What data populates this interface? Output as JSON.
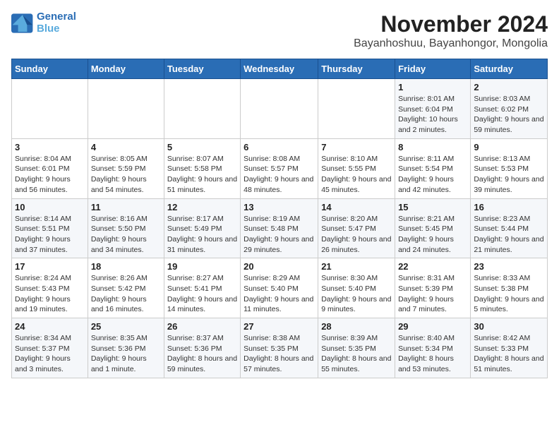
{
  "header": {
    "logo_line1": "General",
    "logo_line2": "Blue",
    "month_title": "November 2024",
    "location": "Bayanhoshuu, Bayanhongor, Mongolia"
  },
  "weekdays": [
    "Sunday",
    "Monday",
    "Tuesday",
    "Wednesday",
    "Thursday",
    "Friday",
    "Saturday"
  ],
  "weeks": [
    [
      {
        "day": "",
        "info": ""
      },
      {
        "day": "",
        "info": ""
      },
      {
        "day": "",
        "info": ""
      },
      {
        "day": "",
        "info": ""
      },
      {
        "day": "",
        "info": ""
      },
      {
        "day": "1",
        "info": "Sunrise: 8:01 AM\nSunset: 6:04 PM\nDaylight: 10 hours and 2 minutes."
      },
      {
        "day": "2",
        "info": "Sunrise: 8:03 AM\nSunset: 6:02 PM\nDaylight: 9 hours and 59 minutes."
      }
    ],
    [
      {
        "day": "3",
        "info": "Sunrise: 8:04 AM\nSunset: 6:01 PM\nDaylight: 9 hours and 56 minutes."
      },
      {
        "day": "4",
        "info": "Sunrise: 8:05 AM\nSunset: 5:59 PM\nDaylight: 9 hours and 54 minutes."
      },
      {
        "day": "5",
        "info": "Sunrise: 8:07 AM\nSunset: 5:58 PM\nDaylight: 9 hours and 51 minutes."
      },
      {
        "day": "6",
        "info": "Sunrise: 8:08 AM\nSunset: 5:57 PM\nDaylight: 9 hours and 48 minutes."
      },
      {
        "day": "7",
        "info": "Sunrise: 8:10 AM\nSunset: 5:55 PM\nDaylight: 9 hours and 45 minutes."
      },
      {
        "day": "8",
        "info": "Sunrise: 8:11 AM\nSunset: 5:54 PM\nDaylight: 9 hours and 42 minutes."
      },
      {
        "day": "9",
        "info": "Sunrise: 8:13 AM\nSunset: 5:53 PM\nDaylight: 9 hours and 39 minutes."
      }
    ],
    [
      {
        "day": "10",
        "info": "Sunrise: 8:14 AM\nSunset: 5:51 PM\nDaylight: 9 hours and 37 minutes."
      },
      {
        "day": "11",
        "info": "Sunrise: 8:16 AM\nSunset: 5:50 PM\nDaylight: 9 hours and 34 minutes."
      },
      {
        "day": "12",
        "info": "Sunrise: 8:17 AM\nSunset: 5:49 PM\nDaylight: 9 hours and 31 minutes."
      },
      {
        "day": "13",
        "info": "Sunrise: 8:19 AM\nSunset: 5:48 PM\nDaylight: 9 hours and 29 minutes."
      },
      {
        "day": "14",
        "info": "Sunrise: 8:20 AM\nSunset: 5:47 PM\nDaylight: 9 hours and 26 minutes."
      },
      {
        "day": "15",
        "info": "Sunrise: 8:21 AM\nSunset: 5:45 PM\nDaylight: 9 hours and 24 minutes."
      },
      {
        "day": "16",
        "info": "Sunrise: 8:23 AM\nSunset: 5:44 PM\nDaylight: 9 hours and 21 minutes."
      }
    ],
    [
      {
        "day": "17",
        "info": "Sunrise: 8:24 AM\nSunset: 5:43 PM\nDaylight: 9 hours and 19 minutes."
      },
      {
        "day": "18",
        "info": "Sunrise: 8:26 AM\nSunset: 5:42 PM\nDaylight: 9 hours and 16 minutes."
      },
      {
        "day": "19",
        "info": "Sunrise: 8:27 AM\nSunset: 5:41 PM\nDaylight: 9 hours and 14 minutes."
      },
      {
        "day": "20",
        "info": "Sunrise: 8:29 AM\nSunset: 5:40 PM\nDaylight: 9 hours and 11 minutes."
      },
      {
        "day": "21",
        "info": "Sunrise: 8:30 AM\nSunset: 5:40 PM\nDaylight: 9 hours and 9 minutes."
      },
      {
        "day": "22",
        "info": "Sunrise: 8:31 AM\nSunset: 5:39 PM\nDaylight: 9 hours and 7 minutes."
      },
      {
        "day": "23",
        "info": "Sunrise: 8:33 AM\nSunset: 5:38 PM\nDaylight: 9 hours and 5 minutes."
      }
    ],
    [
      {
        "day": "24",
        "info": "Sunrise: 8:34 AM\nSunset: 5:37 PM\nDaylight: 9 hours and 3 minutes."
      },
      {
        "day": "25",
        "info": "Sunrise: 8:35 AM\nSunset: 5:36 PM\nDaylight: 9 hours and 1 minute."
      },
      {
        "day": "26",
        "info": "Sunrise: 8:37 AM\nSunset: 5:36 PM\nDaylight: 8 hours and 59 minutes."
      },
      {
        "day": "27",
        "info": "Sunrise: 8:38 AM\nSunset: 5:35 PM\nDaylight: 8 hours and 57 minutes."
      },
      {
        "day": "28",
        "info": "Sunrise: 8:39 AM\nSunset: 5:35 PM\nDaylight: 8 hours and 55 minutes."
      },
      {
        "day": "29",
        "info": "Sunrise: 8:40 AM\nSunset: 5:34 PM\nDaylight: 8 hours and 53 minutes."
      },
      {
        "day": "30",
        "info": "Sunrise: 8:42 AM\nSunset: 5:33 PM\nDaylight: 8 hours and 51 minutes."
      }
    ]
  ]
}
